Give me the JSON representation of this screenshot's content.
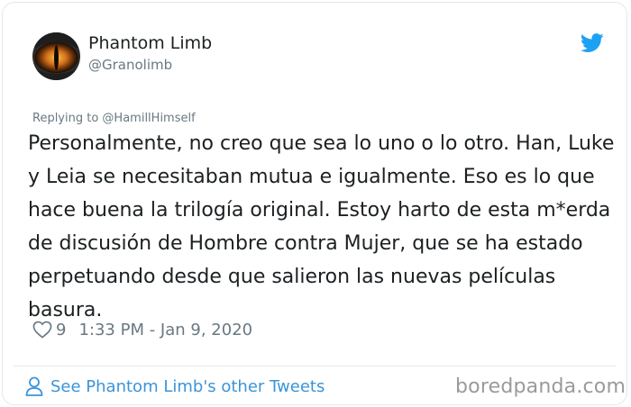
{
  "author": {
    "name": "Phantom Limb",
    "handle": "@Granolimb"
  },
  "tweet": {
    "replying_to": "Replying to @HamillHimself",
    "text": "Personalmente, no creo que sea lo uno o lo otro. Han, Luke y Leia se necesitaban mutua e igualmente. Eso es lo que hace buena la trilogía original. Estoy harto de esta m*erda de discusión de Hombre contra Mujer, que se ha estado perpetuando desde que salieron las nuevas películas basura.",
    "likes": "9",
    "timestamp": "1:33 PM - Jan 9, 2020"
  },
  "footer": {
    "see_more": "See Phantom Limb's other Tweets"
  },
  "watermark": "boredpanda.com",
  "colors": {
    "twitter_blue": "#1da1f2",
    "link_blue": "#3b94d9",
    "meta_gray": "#697882"
  },
  "icons": [
    "avatar",
    "twitter-bird-icon",
    "heart-icon",
    "person-icon"
  ]
}
